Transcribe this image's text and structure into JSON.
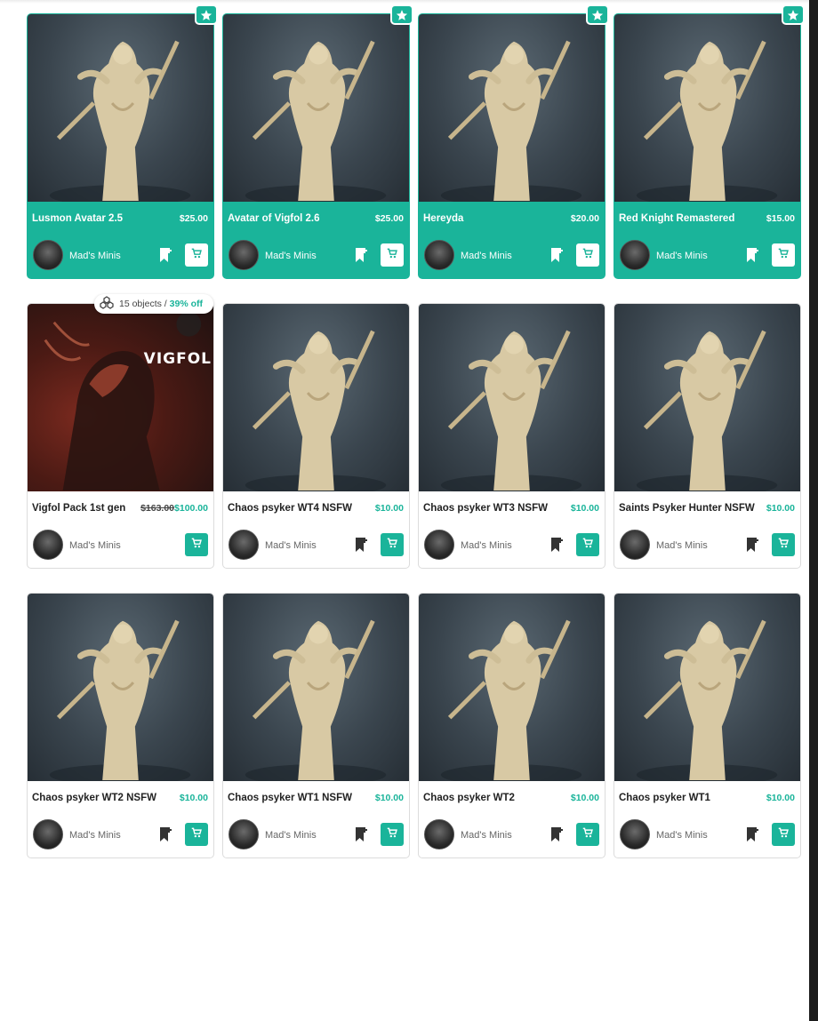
{
  "seller_name": "Mad's Minis",
  "pack_badge": {
    "objects": "15 objects",
    "sep": "/",
    "discount": "39% off"
  },
  "products": [
    {
      "title": "Lusmon Avatar 2.5",
      "price": "$25.00",
      "featured": true
    },
    {
      "title": "Avatar of Vigfol 2.6",
      "price": "$25.00",
      "featured": true
    },
    {
      "title": "Hereyda",
      "price": "$20.00",
      "featured": true
    },
    {
      "title": "Red Knight Remastered",
      "price": "$15.00",
      "featured": true
    },
    {
      "title": "Vigfol Pack 1st gen",
      "old_price": "$163.00",
      "price": "$100.00",
      "featured": false,
      "pack": true,
      "image_text": "VIGFOL"
    },
    {
      "title": "Chaos psyker WT4 NSFW",
      "price": "$10.00",
      "featured": false
    },
    {
      "title": "Chaos psyker WT3 NSFW",
      "price": "$10.00",
      "featured": false
    },
    {
      "title": "Saints Psyker Hunter NSFW",
      "price": "$10.00",
      "featured": false
    },
    {
      "title": "Chaos psyker WT2 NSFW",
      "price": "$10.00",
      "featured": false
    },
    {
      "title": "Chaos psyker WT1 NSFW",
      "price": "$10.00",
      "featured": false
    },
    {
      "title": "Chaos psyker WT2",
      "price": "$10.00",
      "featured": false
    },
    {
      "title": "Chaos psyker WT1",
      "price": "$10.00",
      "featured": false
    }
  ],
  "colors": {
    "accent": "#1ab49a",
    "text": "#222222",
    "muted": "#666666"
  },
  "icons": {
    "featured": "star-icon",
    "cart": "shopping-cart-icon",
    "bookmark": "bookmark-add-icon",
    "pack": "objects-stack-icon"
  }
}
